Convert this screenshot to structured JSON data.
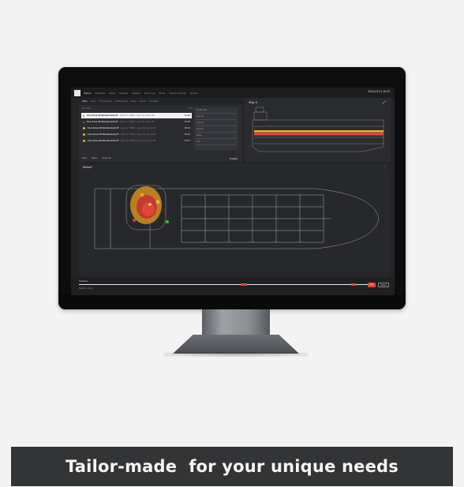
{
  "topbar": {
    "nav_items": [
      "Alarms",
      "Overview",
      "Zones",
      "Sensors",
      "Devices",
      "Event Log",
      "About",
      "System Settings",
      "Service"
    ],
    "datetime": "2024-03-01 15:29"
  },
  "alarm_panel": {
    "tabs": [
      "Alarm",
      "Active",
      "Fire Detection",
      "Disablements",
      "Faults",
      "Events",
      "Test Mode"
    ],
    "header": {
      "left": "Fire Alarm",
      "right": "Time"
    },
    "rows": [
      {
        "title": "Fire Zone 20 Smoke Heat 27",
        "sub": "Zone 27 FIRE, Loop 16, Zone 20",
        "time": "15:29",
        "status": "alarm",
        "selected": true
      },
      {
        "title": "Fire Zone 20 Smoke Heat 27",
        "sub": "Zone 27 FIRE, Loop 16, Zone 20",
        "time": "15:28",
        "status": "alarm",
        "selected": false
      },
      {
        "title": "Fire Zone 20 Smoke Heat 27",
        "sub": "Zone 27 FIRE, Loop 16, Zone 20",
        "time": "15:02",
        "status": "warning",
        "selected": false
      },
      {
        "title": "Fire Zone 20 Smoke Heat 27",
        "sub": "Zone 27 FIRE, Loop 16, Zone 20",
        "time": "15:02",
        "status": "warning",
        "selected": false
      },
      {
        "title": "Fire Zone 20 Smoke Heat 27",
        "sub": "Zone 27 FIRE, Loop 16, Zone 20",
        "time": "15:01",
        "status": "warning",
        "selected": false
      }
    ],
    "detail_fields": [
      "Smoke Heat",
      "Zone 20",
      "Loop 16",
      "Detector",
      "Status",
      "Time"
    ],
    "actions": [
      "Mute",
      "Reset",
      "Reset All"
    ],
    "disable_label": "Disable"
  },
  "ship_panel": {
    "title": "Ship X"
  },
  "plan_panel": {
    "title": "\"default\""
  },
  "timeline": {
    "label": "Timeline",
    "sub": "Realtime mode",
    "live_label": "Live",
    "history_label": "History"
  },
  "caption": "Tailor-made  for your unique needs",
  "colors": {
    "alarm": "#e0453b",
    "warning": "#e8b23a",
    "ok": "#4caf50",
    "screen": "#232426"
  }
}
